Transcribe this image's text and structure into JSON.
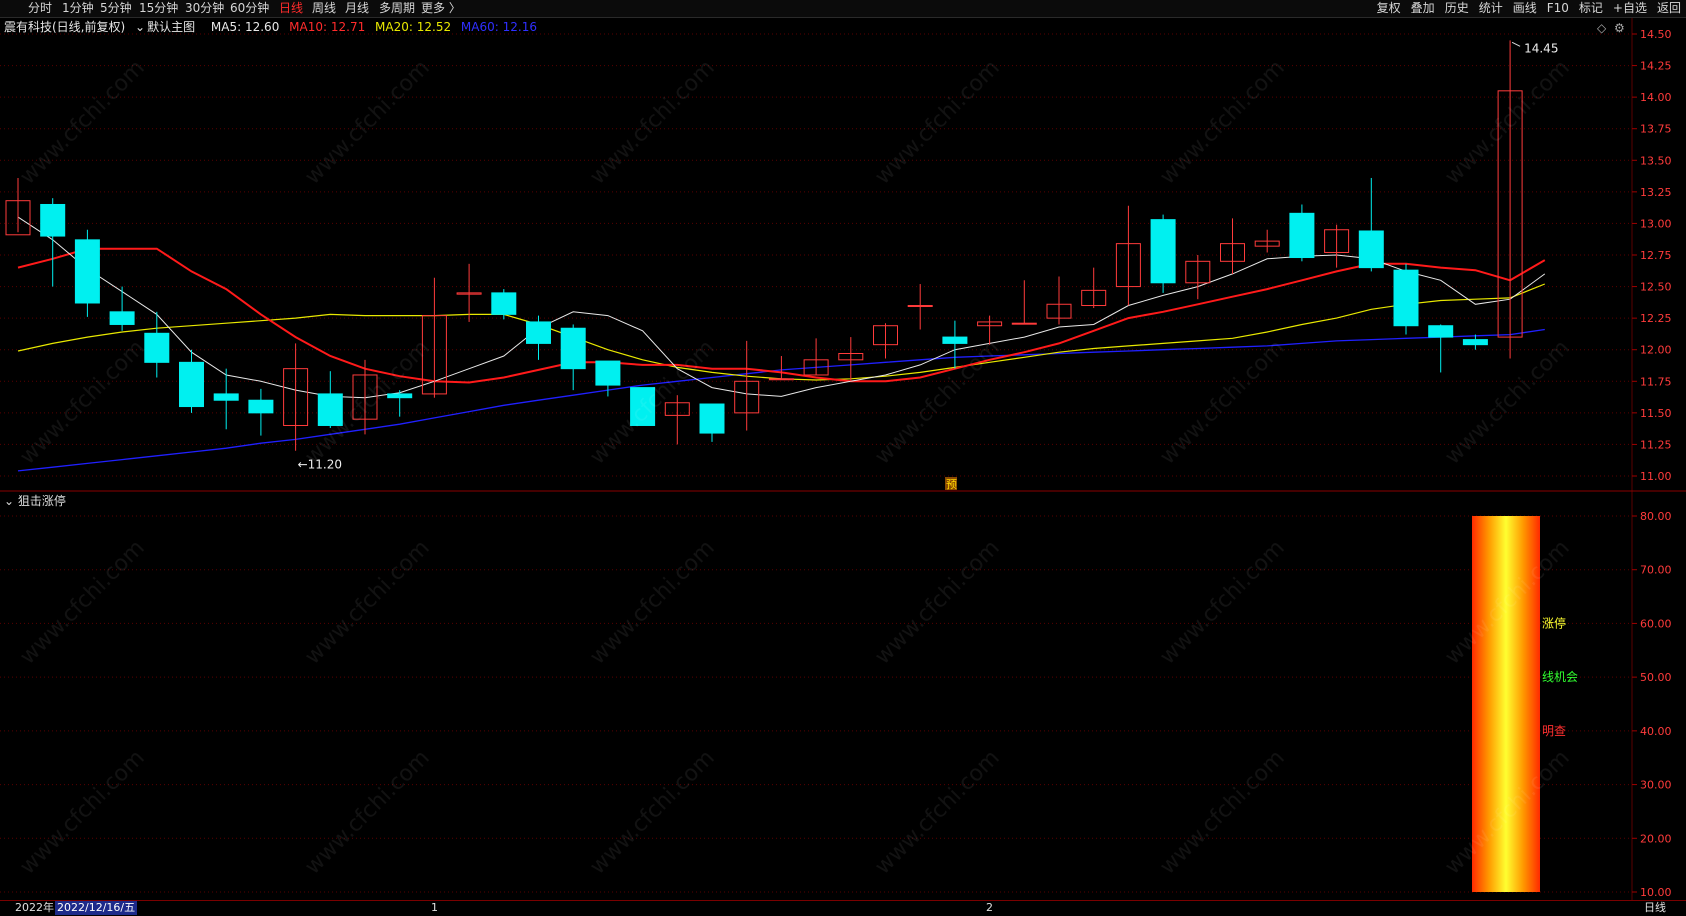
{
  "toolbar": {
    "periods": [
      "分时",
      "1分钟",
      "5分钟",
      "15分钟",
      "30分钟",
      "60分钟",
      "日线",
      "周线",
      "月线",
      "多周期",
      "更多 〉"
    ],
    "active_period": "日线",
    "right": [
      "复权",
      "叠加",
      "历史",
      "统计",
      "画线",
      "F10",
      "标记",
      "+自选",
      "返回"
    ]
  },
  "main_chart": {
    "title": "震有科技(日线,前复权)",
    "template": "默认主图",
    "ma5": "MA5: 12.60",
    "ma10": "MA10: 12.71",
    "ma20": "MA20: 12.52",
    "ma60": "MA60: 12.16",
    "high_label": "14.45",
    "low_label": "11.20",
    "forecast_mark": "预",
    "y_ticks": [
      "14.50",
      "14.25",
      "14.00",
      "13.75",
      "13.50",
      "13.25",
      "13.00",
      "12.75",
      "12.50",
      "12.25",
      "12.00",
      "11.75",
      "11.50",
      "11.25",
      "11.00"
    ]
  },
  "sub_chart": {
    "title": "狙击涨停",
    "y_ticks": [
      "80.00",
      "70.00",
      "60.00",
      "50.00",
      "40.00",
      "30.00",
      "20.00",
      "10.00"
    ],
    "labels": [
      "涨停",
      "线机会",
      "明查"
    ],
    "bar_low": 10,
    "bar_high": 80
  },
  "statusbar": {
    "year": "2022年",
    "date": "2022/12/16/五",
    "month1": "1",
    "month2": "2",
    "period": "日线"
  },
  "watermark": "www.cfchi.com",
  "colors": {
    "up": "#ff3b3b",
    "down": "#00f0f0",
    "ma5": "#e8e8e8",
    "ma10": "#ff1a1a",
    "ma20": "#e8e800",
    "ma60": "#2020ff",
    "grid": "#5a0000"
  },
  "chart_data": {
    "type": "candlestick",
    "candles": [
      {
        "o": 12.91,
        "c": 13.18,
        "h": 13.36,
        "l": 12.93
      },
      {
        "o": 13.15,
        "c": 12.9,
        "h": 13.2,
        "l": 12.5
      },
      {
        "o": 12.87,
        "c": 12.37,
        "h": 12.95,
        "l": 12.26
      },
      {
        "o": 12.3,
        "c": 12.2,
        "h": 12.5,
        "l": 12.15
      },
      {
        "o": 12.13,
        "c": 11.9,
        "h": 12.3,
        "l": 11.78
      },
      {
        "o": 11.9,
        "c": 11.55,
        "h": 12.0,
        "l": 11.5
      },
      {
        "o": 11.65,
        "c": 11.6,
        "h": 11.85,
        "l": 11.37
      },
      {
        "o": 11.6,
        "c": 11.5,
        "h": 11.69,
        "l": 11.32
      },
      {
        "o": 11.4,
        "c": 11.85,
        "h": 12.05,
        "l": 11.2
      },
      {
        "o": 11.65,
        "c": 11.4,
        "h": 11.83,
        "l": 11.38
      },
      {
        "o": 11.45,
        "c": 11.8,
        "h": 11.92,
        "l": 11.33
      },
      {
        "o": 11.65,
        "c": 11.62,
        "h": 11.68,
        "l": 11.47
      },
      {
        "o": 11.65,
        "c": 12.27,
        "h": 12.57,
        "l": 11.62
      },
      {
        "o": 12.44,
        "c": 12.45,
        "h": 12.68,
        "l": 12.22
      },
      {
        "o": 12.45,
        "c": 12.28,
        "h": 12.48,
        "l": 12.24
      },
      {
        "o": 12.22,
        "c": 12.05,
        "h": 12.27,
        "l": 11.92
      },
      {
        "o": 12.17,
        "c": 11.85,
        "h": 12.2,
        "l": 11.68
      },
      {
        "o": 11.91,
        "c": 11.72,
        "h": 11.91,
        "l": 11.63
      },
      {
        "o": 11.7,
        "c": 11.4,
        "h": 11.7,
        "l": 11.4
      },
      {
        "o": 11.48,
        "c": 11.58,
        "h": 11.64,
        "l": 11.25
      },
      {
        "o": 11.57,
        "c": 11.34,
        "h": 11.57,
        "l": 11.27
      },
      {
        "o": 11.5,
        "c": 11.75,
        "h": 12.07,
        "l": 11.36
      },
      {
        "o": 11.77,
        "c": 11.77,
        "h": 11.95,
        "l": 11.77
      },
      {
        "o": 11.8,
        "c": 11.92,
        "h": 12.09,
        "l": 11.8
      },
      {
        "o": 11.92,
        "c": 11.97,
        "h": 12.1,
        "l": 11.75
      },
      {
        "o": 12.04,
        "c": 12.19,
        "h": 12.21,
        "l": 11.93
      },
      {
        "o": 12.35,
        "c": 12.35,
        "h": 12.52,
        "l": 12.16
      },
      {
        "o": 12.1,
        "c": 12.05,
        "h": 12.23,
        "l": 11.85
      },
      {
        "o": 12.19,
        "c": 12.22,
        "h": 12.27,
        "l": 12.04
      },
      {
        "o": 12.21,
        "c": 12.21,
        "h": 12.55,
        "l": 12.21
      },
      {
        "o": 12.25,
        "c": 12.36,
        "h": 12.58,
        "l": 12.2
      },
      {
        "o": 12.35,
        "c": 12.47,
        "h": 12.65,
        "l": 12.33
      },
      {
        "o": 12.5,
        "c": 12.84,
        "h": 13.14,
        "l": 12.35
      },
      {
        "o": 13.03,
        "c": 12.53,
        "h": 13.07,
        "l": 12.45
      },
      {
        "o": 12.53,
        "c": 12.7,
        "h": 12.75,
        "l": 12.4
      },
      {
        "o": 12.7,
        "c": 12.84,
        "h": 13.04,
        "l": 12.6
      },
      {
        "o": 12.82,
        "c": 12.86,
        "h": 12.95,
        "l": 12.77
      },
      {
        "o": 13.08,
        "c": 12.73,
        "h": 13.15,
        "l": 12.7
      },
      {
        "o": 12.77,
        "c": 12.95,
        "h": 12.99,
        "l": 12.65
      },
      {
        "o": 12.94,
        "c": 12.65,
        "h": 13.36,
        "l": 12.62
      },
      {
        "o": 12.63,
        "c": 12.19,
        "h": 12.68,
        "l": 12.12
      },
      {
        "o": 12.19,
        "c": 12.1,
        "h": 12.2,
        "l": 11.82
      },
      {
        "o": 12.08,
        "c": 12.04,
        "h": 12.12,
        "l": 12.0
      },
      {
        "o": 12.1,
        "c": 14.05,
        "h": 14.45,
        "l": 11.93
      }
    ],
    "ma5": [
      13.05,
      12.87,
      12.64,
      12.46,
      12.28,
      11.98,
      11.8,
      11.75,
      11.68,
      11.63,
      11.62,
      11.66,
      11.75,
      11.85,
      11.95,
      12.17,
      12.3,
      12.27,
      12.15,
      11.85,
      11.7,
      11.65,
      11.63,
      11.7,
      11.75,
      11.8,
      11.88,
      12.0,
      12.05,
      12.1,
      12.18,
      12.2,
      12.35,
      12.43,
      12.5,
      12.6,
      12.72,
      12.74,
      12.75,
      12.72,
      12.62,
      12.55,
      12.36,
      12.4,
      12.6
    ],
    "ma10": [
      12.65,
      12.72,
      12.8,
      12.8,
      12.8,
      12.62,
      12.48,
      12.28,
      12.1,
      11.95,
      11.85,
      11.79,
      11.75,
      11.74,
      11.78,
      11.84,
      11.9,
      11.9,
      11.88,
      11.88,
      11.85,
      11.85,
      11.82,
      11.78,
      11.75,
      11.75,
      11.78,
      11.85,
      11.92,
      11.98,
      12.05,
      12.15,
      12.25,
      12.3,
      12.36,
      12.42,
      12.48,
      12.55,
      12.62,
      12.68,
      12.68,
      12.65,
      12.63,
      12.55,
      12.71
    ],
    "ma20": [
      11.99,
      12.05,
      12.1,
      12.14,
      12.17,
      12.19,
      12.21,
      12.23,
      12.25,
      12.28,
      12.27,
      12.27,
      12.27,
      12.28,
      12.28,
      12.2,
      12.1,
      12.0,
      11.92,
      11.86,
      11.82,
      11.79,
      11.77,
      11.76,
      11.77,
      11.79,
      11.82,
      11.86,
      11.9,
      11.94,
      11.98,
      12.01,
      12.03,
      12.05,
      12.07,
      12.09,
      12.14,
      12.2,
      12.25,
      12.32,
      12.36,
      12.39,
      12.4,
      12.41,
      12.52
    ],
    "ma60": [
      11.04,
      11.07,
      11.1,
      11.13,
      11.16,
      11.19,
      11.22,
      11.26,
      11.29,
      11.33,
      11.37,
      11.41,
      11.46,
      11.51,
      11.56,
      11.6,
      11.64,
      11.68,
      11.72,
      11.75,
      11.78,
      11.81,
      11.84,
      11.86,
      11.88,
      11.9,
      11.92,
      11.94,
      11.95,
      11.96,
      11.97,
      11.98,
      11.99,
      12.0,
      12.01,
      12.02,
      12.03,
      12.05,
      12.07,
      12.08,
      12.09,
      12.1,
      12.11,
      12.12,
      12.16
    ]
  }
}
